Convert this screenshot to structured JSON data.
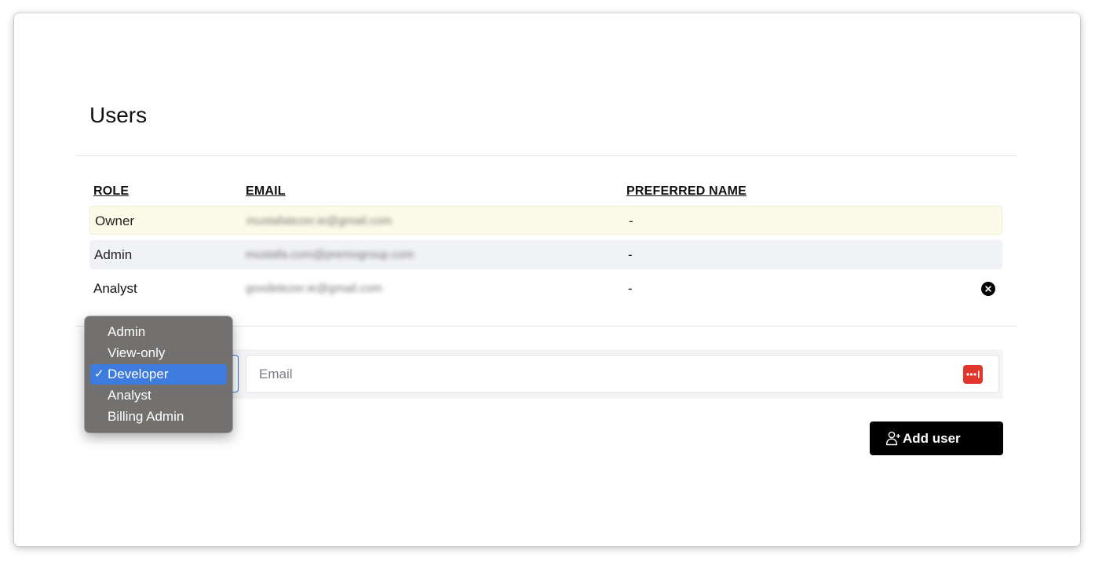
{
  "page": {
    "title": "Users"
  },
  "table": {
    "headers": [
      "ROLE",
      "EMAIL",
      "PREFERRED NAME"
    ],
    "rows": [
      {
        "role": "Owner",
        "email": "mustafatezer.ie@gmail.com",
        "preferred_name": "-",
        "bg": "#fcfbe9",
        "removable": false
      },
      {
        "role": "Admin",
        "email": "mustafa.com@premogroup.com",
        "preferred_name": "-",
        "bg": "#f1f2f5",
        "removable": false
      },
      {
        "role": "Analyst",
        "email": "goodetezer.ie@gmail.com",
        "preferred_name": "-",
        "bg": "#ffffff",
        "removable": true
      }
    ]
  },
  "add_user": {
    "role_options": [
      "Admin",
      "View-only",
      "Developer",
      "Analyst",
      "Billing Admin"
    ],
    "selected_role": "Developer",
    "email_placeholder": "Email",
    "email_value": "",
    "button_label": "Add user"
  },
  "icons": {
    "remove": "close-circle-icon",
    "password_manager": "password-dots-icon",
    "add_user": "user-plus-icon",
    "check": "checkmark-icon"
  },
  "colors": {
    "accent": "#3d7bde",
    "owner_row": "#fcfbe9",
    "admin_row": "#f1f2f5",
    "button": "#000000",
    "password_icon": "#e0362c"
  }
}
